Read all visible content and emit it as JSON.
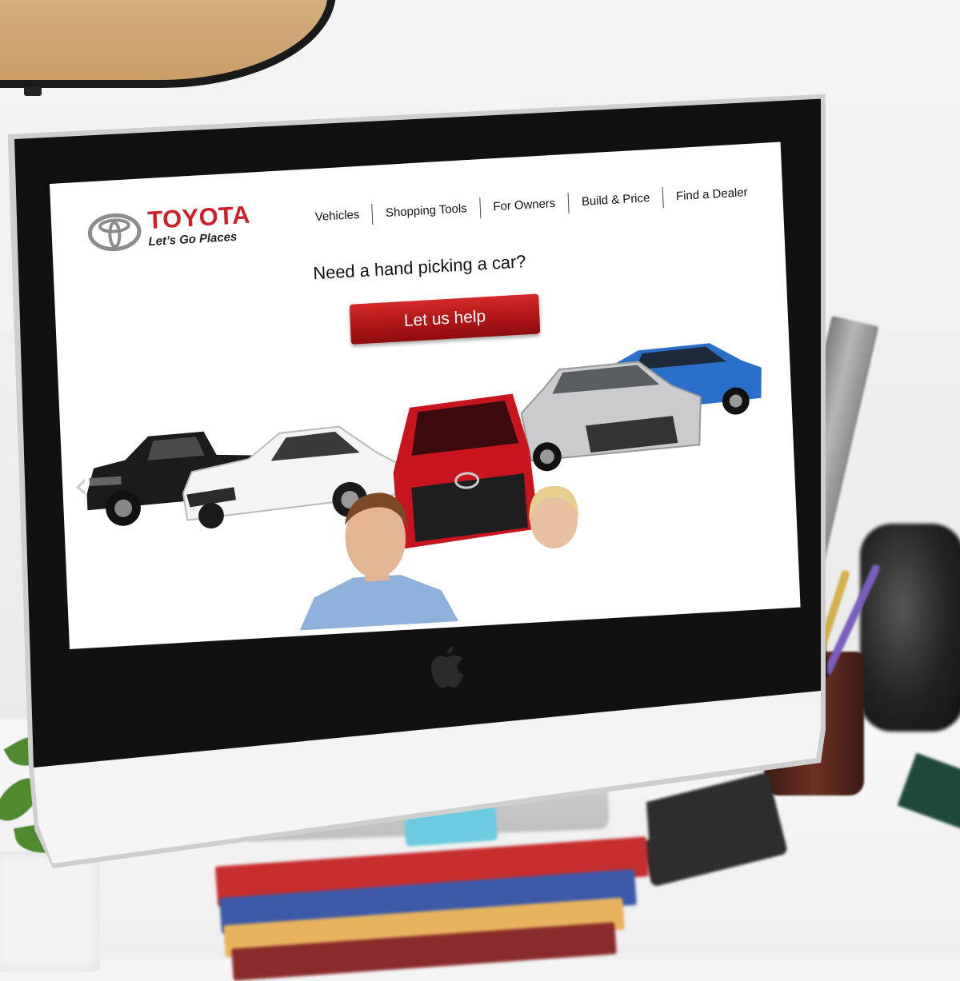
{
  "brand": {
    "name": "TOYOTA",
    "tagline": "Let’s Go Places",
    "color": "#d01e2a"
  },
  "nav": {
    "items": [
      {
        "label": "Vehicles"
      },
      {
        "label": "Shopping Tools"
      },
      {
        "label": "For Owners"
      },
      {
        "label": "Build & Price"
      },
      {
        "label": "Find a Dealer"
      }
    ]
  },
  "hero": {
    "headline": "Need a hand picking a car?",
    "cta_label": "Let us help",
    "cta_color": "#b11717"
  },
  "carousel": {
    "prev_icon": "chevron-left-icon",
    "next_icon": "chevron-right-icon",
    "prev_glyph": "‹",
    "next_glyph": "›",
    "vehicles": [
      {
        "name": "pickup-truck",
        "color": "#1b1b1b"
      },
      {
        "name": "white-sedan",
        "color": "#f4f4f4"
      },
      {
        "name": "red-sedan",
        "color": "#c8141c"
      },
      {
        "name": "silver-sedan",
        "color": "#c9cbcd"
      },
      {
        "name": "blue-suv",
        "color": "#2a6fc9"
      }
    ]
  }
}
